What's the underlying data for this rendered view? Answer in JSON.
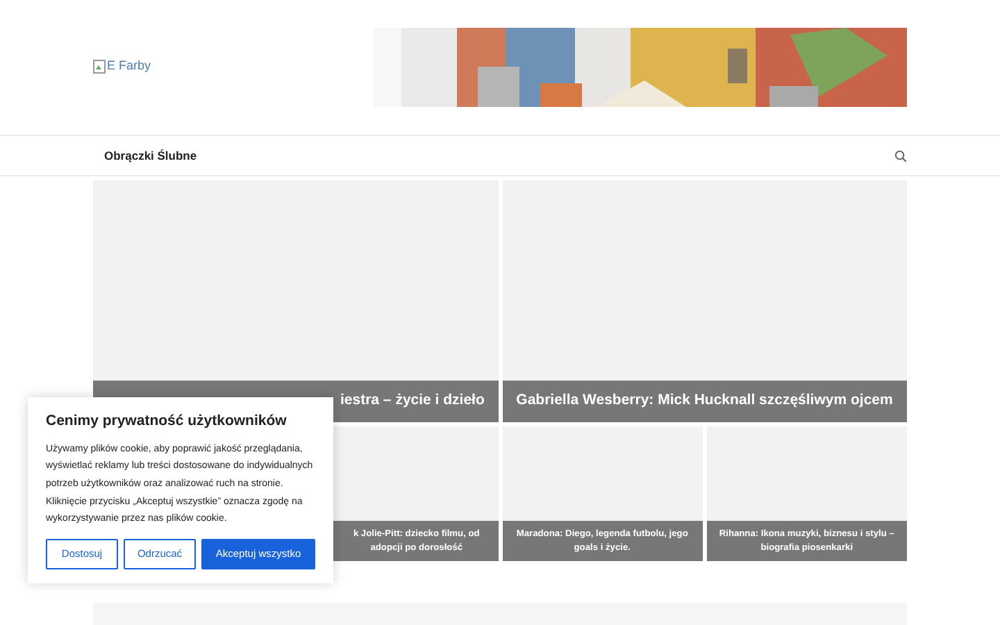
{
  "header": {
    "logo_alt": "E Farby"
  },
  "nav": {
    "items": [
      {
        "label": "Obrączki Ślubne"
      }
    ]
  },
  "featured": [
    {
      "title": "iestra – życie i dzieło"
    },
    {
      "title": "Gabriella Wesberry: Mick Hucknall szczęśliwym ojcem"
    }
  ],
  "posts": [
    {
      "title": "k Jolie-Pitt: dziecko filmu, od adopcji po dorosłość"
    },
    {
      "title": "Maradona: Diego, legenda futbolu, jego goals i życie."
    },
    {
      "title": "Rihanna: Ikona muzyki, biznesu i stylu – biografia piosenkarki"
    }
  ],
  "cookie_banner": {
    "title": "Cenimy prywatność użytkowników",
    "text": "Używamy plików cookie, aby poprawić jakość przeglądania, wyświetlać reklamy lub treści dostosowane do indywidualnych potrzeb użytkowników oraz analizować ruch na stronie. Kliknięcie przycisku „Akceptuj wszystkie” oznacza zgodę na wykorzystywanie przez nas plików cookie.",
    "buttons": [
      {
        "label": "Dostosuj",
        "kind": "outline"
      },
      {
        "label": "Odrzucać",
        "kind": "outline"
      },
      {
        "label": "Akceptuj wszystko",
        "kind": "primary"
      }
    ]
  }
}
